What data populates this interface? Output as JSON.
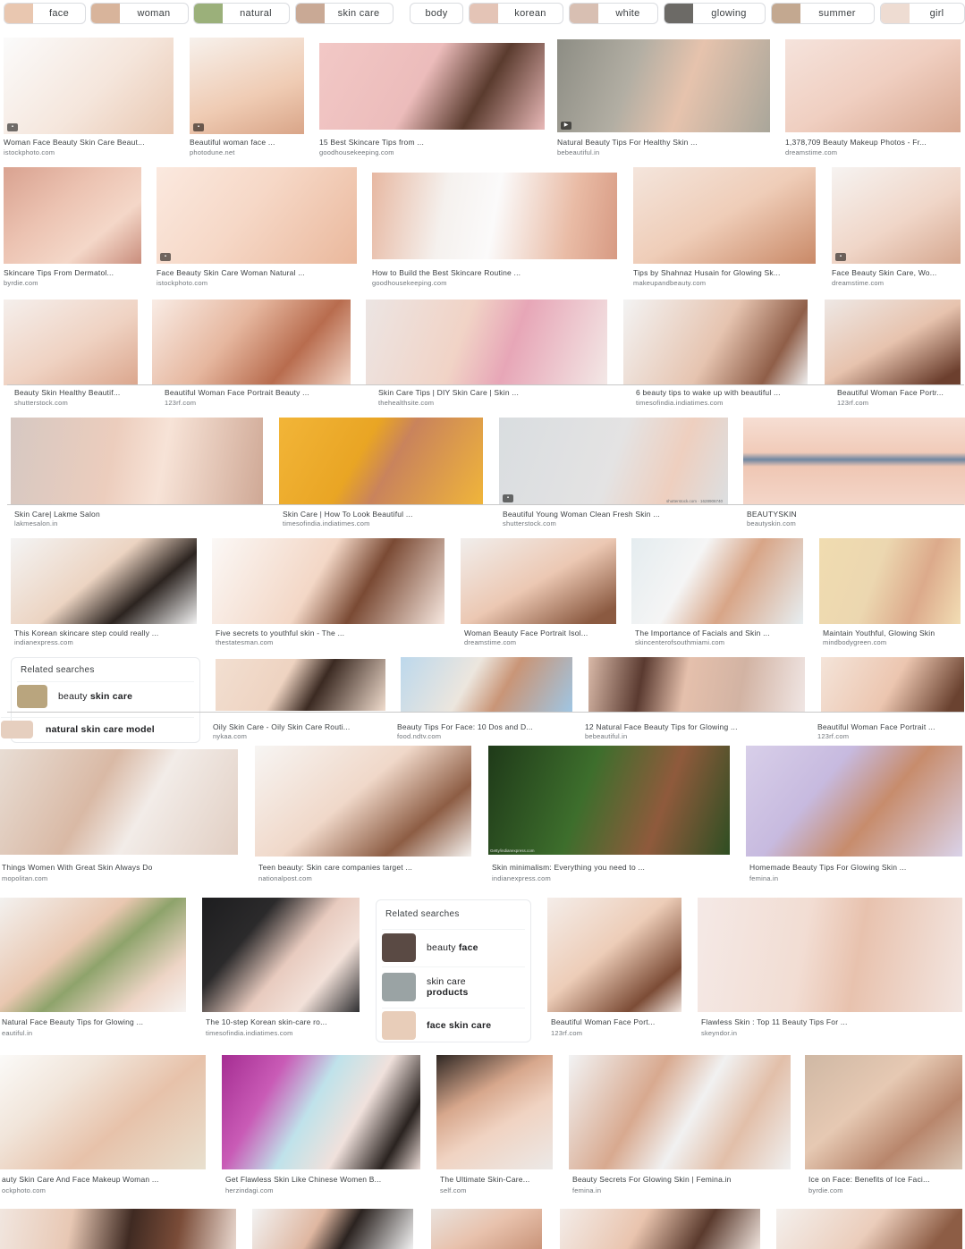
{
  "chips": [
    {
      "label": "face",
      "color": "#e9c7b0"
    },
    {
      "label": "woman",
      "color": "#d8b49b"
    },
    {
      "label": "natural",
      "color": "#9bb07a"
    },
    {
      "label": "skin care",
      "color": "#c9a995"
    },
    {
      "label": "body",
      "color": "#ffffff"
    },
    {
      "label": "korean",
      "color": "#e4c4b6"
    },
    {
      "label": "white",
      "color": "#d8bfb2"
    },
    {
      "label": "glowing",
      "color": "#6c6a66"
    },
    {
      "label": "summer",
      "color": "#c3a890"
    },
    {
      "label": "girl",
      "color": "#eedcd2"
    }
  ],
  "results": [
    {
      "caption": "Woman Face Beauty Skin Care Beaut...",
      "source": "istockphoto.com"
    },
    {
      "caption": "Beautiful woman face ...",
      "source": "photodune.net"
    },
    {
      "caption": "15 Best Skincare Tips from ...",
      "source": "goodhousekeeping.com"
    },
    {
      "caption": "Natural Beauty Tips For Healthy Skin ...",
      "source": "bebeautiful.in"
    },
    {
      "caption": "1,378,709 Beauty Makeup Photos - Fr...",
      "source": "dreamstime.com"
    },
    {
      "caption": "Skincare Tips From Dermatol...",
      "source": "byrdie.com"
    },
    {
      "caption": "Face Beauty Skin Care Woman Natural ...",
      "source": "istockphoto.com"
    },
    {
      "caption": "How to Build the Best Skincare Routine ...",
      "source": "goodhousekeeping.com"
    },
    {
      "caption": "Tips by Shahnaz Husain for Glowing Sk...",
      "source": "makeupandbeauty.com"
    },
    {
      "caption": "Face Beauty Skin Care, Wo...",
      "source": "dreamstime.com"
    },
    {
      "caption": "Beauty Skin Healthy Beautif...",
      "source": "shutterstock.com"
    },
    {
      "caption": "Beautiful Woman Face Portrait Beauty ...",
      "source": "123rf.com"
    },
    {
      "caption": "Skin Care Tips | DIY Skin Care | Skin ...",
      "source": "thehealthsite.com"
    },
    {
      "caption": "6 beauty tips to wake up with beautiful ...",
      "source": "timesofindia.indiatimes.com"
    },
    {
      "caption": "Beautiful Woman Face Portr...",
      "source": "123rf.com"
    },
    {
      "caption": "Skin Care| Lakme Salon",
      "source": "lakmesalon.in"
    },
    {
      "caption": "Skin Care | How To Look Beautiful ...",
      "source": "timesofindia.indiatimes.com"
    },
    {
      "caption": "Beautiful Young Woman Clean Fresh Skin ...",
      "source": "shutterstock.com"
    },
    {
      "caption": "BEAUTYSKIN",
      "source": "beautyskin.com"
    },
    {
      "caption": "This Korean skincare step could really ...",
      "source": "indianexpress.com"
    },
    {
      "caption": "Five secrets to youthful skin - The ...",
      "source": "thestatesman.com"
    },
    {
      "caption": "Woman Beauty Face Portrait Isol...",
      "source": "dreamstime.com"
    },
    {
      "caption": "The Importance of Facials and Skin ...",
      "source": "skincenterofsouthmiami.com"
    },
    {
      "caption": "Maintain Youthful, Glowing Skin",
      "source": "mindbodygreen.com"
    },
    {
      "caption": "Oily Skin Care - Oily Skin Care Routi...",
      "source": "nykaa.com"
    },
    {
      "caption": "Beauty Tips For Face: 10 Dos and D...",
      "source": "food.ndtv.com"
    },
    {
      "caption": "12 Natural Face Beauty Tips for Glowing ...",
      "source": "bebeautiful.in"
    },
    {
      "caption": "Beautiful Woman Face Portrait ...",
      "source": "123rf.com"
    },
    {
      "caption": "Things Women With Great Skin Always Do",
      "source": "mopolitan.com"
    },
    {
      "caption": "Teen beauty: Skin care companies target ...",
      "source": "nationalpost.com"
    },
    {
      "caption": "Skin minimalism: Everything you need to ...",
      "source": "indianexpress.com"
    },
    {
      "caption": "Homemade Beauty Tips For Glowing Skin ...",
      "source": "femina.in"
    },
    {
      "caption": "Natural Face Beauty Tips for Glowing ...",
      "source": "eautiful.in"
    },
    {
      "caption": "The 10-step Korean skin-care ro...",
      "source": "timesofindia.indiatimes.com"
    },
    {
      "caption": "Beautiful Woman Face Port...",
      "source": "123rf.com"
    },
    {
      "caption": "Flawless Skin : Top 11 Beauty Tips For ...",
      "source": "skeyndor.in"
    },
    {
      "caption": "auty Skin Care And Face Makeup Woman ...",
      "source": "ockphoto.com"
    },
    {
      "caption": "Get Flawless Skin Like Chinese Women B...",
      "source": "herzindagi.com"
    },
    {
      "caption": "The Ultimate Skin-Care...",
      "source": "self.com"
    },
    {
      "caption": "Beauty Secrets For Glowing Skin | Femina.in",
      "source": "femina.in"
    },
    {
      "caption": "Ice on Face: Benefits of Ice Faci...",
      "source": "byrdie.com"
    }
  ],
  "related_a": {
    "title": "Related searches",
    "items": [
      {
        "plain": "beauty ",
        "bold": "skin care",
        "color": "#b9a57e"
      },
      {
        "plain": "",
        "bold": "natural skin care model",
        "color": "#e6cfbf"
      }
    ]
  },
  "related_b": {
    "title": "Related searches",
    "items": [
      {
        "plain": "beauty ",
        "bold": "face",
        "color": "#5a4a44"
      },
      {
        "plain": "skin care ",
        "bold": "products",
        "color": "#9aa3a4"
      },
      {
        "plain": "",
        "bold": "face skin care",
        "color": "#e8cdb9"
      }
    ]
  },
  "overlay_texts": {
    "watermark": "shutterstock.com · 1628906740",
    "credit": "Getty/indianexpress.com"
  }
}
